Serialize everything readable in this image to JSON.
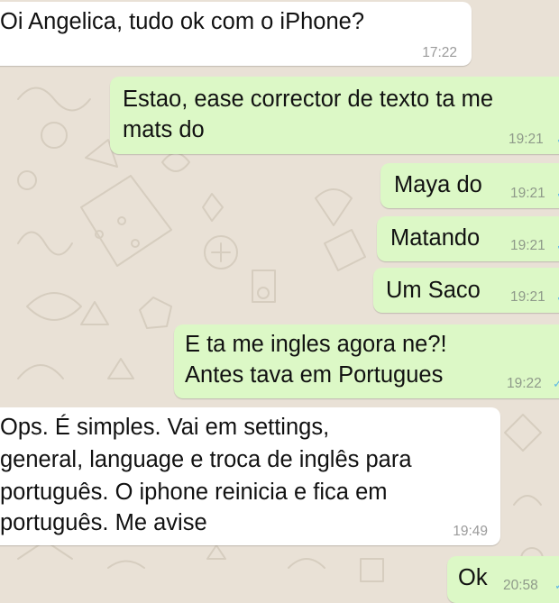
{
  "theme": {
    "wallpaper_color": "#e9e1d6",
    "incoming_bubble_color": "#ffffff",
    "outgoing_bubble_color": "#dcf8c6",
    "read_tick_color": "#5cb7e6"
  },
  "chat": {
    "messages": [
      {
        "direction": "incoming",
        "lines": [
          "Oi Angelica, tudo ok com o iPhone?"
        ],
        "time": "17:22"
      },
      {
        "direction": "outgoing",
        "lines": [
          "Estao, ease corrector de texto ta me",
          "mats do"
        ],
        "time": "19:21",
        "status_icon": "read-receipt-icon"
      },
      {
        "direction": "outgoing",
        "lines": [
          "Maya do"
        ],
        "time": "19:21",
        "status_icon": "read-receipt-icon"
      },
      {
        "direction": "outgoing",
        "lines": [
          "Matando"
        ],
        "time": "19:21",
        "status_icon": "read-receipt-icon"
      },
      {
        "direction": "outgoing",
        "lines": [
          "Um Saco"
        ],
        "time": "19:21",
        "status_icon": "read-receipt-icon"
      },
      {
        "direction": "outgoing",
        "lines": [
          "E ta me ingles agora ne?!",
          "Antes tava em Portugues"
        ],
        "time": "19:22",
        "status_icon": "read-receipt-icon"
      },
      {
        "direction": "incoming",
        "lines": [
          "Ops. É simples. Vai em settings,",
          "general, language e troca de inglês para",
          "português. O iphone reinicia e fica em",
          "português. Me avise"
        ],
        "time": "19:49"
      },
      {
        "direction": "outgoing",
        "lines": [
          "Ok"
        ],
        "time": "20:58",
        "status_icon": "read-receipt-icon"
      }
    ]
  }
}
